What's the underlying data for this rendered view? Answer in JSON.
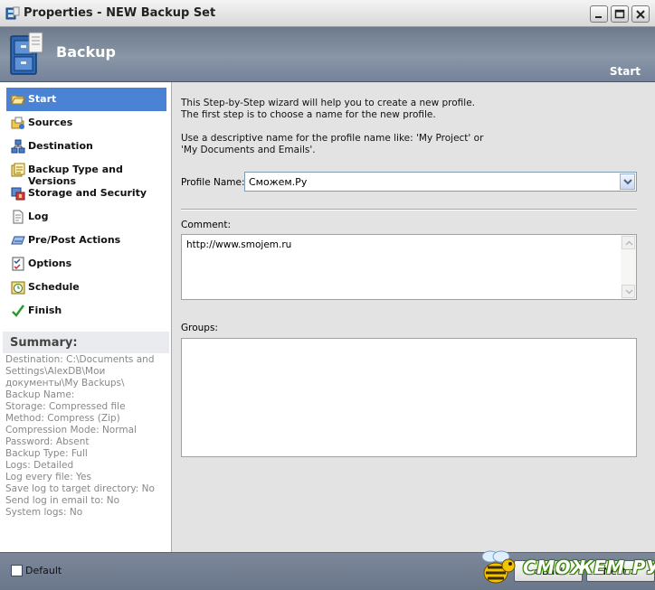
{
  "window": {
    "title": "Properties - NEW Backup Set"
  },
  "header": {
    "title": "Backup",
    "step": "Start"
  },
  "sidebar": {
    "items": [
      {
        "label": "Start",
        "icon": "folder-open-icon"
      },
      {
        "label": "Sources",
        "icon": "sources-icon"
      },
      {
        "label": "Destination",
        "icon": "network-icon"
      },
      {
        "label": "Backup Type and Versions",
        "icon": "backup-type-icon"
      },
      {
        "label": "Storage and Security",
        "icon": "storage-icon"
      },
      {
        "label": "Log",
        "icon": "log-icon"
      },
      {
        "label": "Pre/Post Actions",
        "icon": "actions-icon"
      },
      {
        "label": "Options",
        "icon": "options-icon"
      },
      {
        "label": "Schedule",
        "icon": "schedule-icon"
      },
      {
        "label": "Finish",
        "icon": "checkmark-icon"
      }
    ],
    "active_index": 0,
    "summary_title": "Summary:",
    "summary_lines": [
      "Destination: C:\\Documents and Settings\\AlexDB\\Мои документы\\My Backups\\",
      "Backup Name:",
      "Storage: Compressed file",
      "Method: Compress (Zip)",
      "Compression Mode: Normal",
      "Password: Absent",
      "Backup Type: Full",
      "Logs: Detailed",
      "Log every file: Yes",
      "Save log to target directory: No",
      "Send log in email to: No",
      "System logs: No"
    ]
  },
  "main": {
    "intro_line1": "This Step-by-Step wizard will help you to create a new profile.",
    "intro_line2": "The first step is to choose a name  for the new profile.",
    "hint_line1": "Use a descriptive name for the profile name like: 'My Project' or",
    "hint_line2": "'My Documents and Emails'.",
    "profile_name_label": "Profile Name:",
    "profile_name_value": "Сможем.Ру",
    "comment_label": "Comment:",
    "comment_value": "http://www.smojem.ru",
    "groups_label": "Groups:"
  },
  "footer": {
    "default_label": "Default",
    "default_checked": false,
    "back_label": "< Back",
    "next_label": "Next >",
    "watermark": "СМОЖЕМ.РУ"
  },
  "colors": {
    "header_bg": "#7f8c9e",
    "active_item": "#4a83d4",
    "content_bg": "#e3e3e3",
    "footer_bg": "#737f92"
  }
}
